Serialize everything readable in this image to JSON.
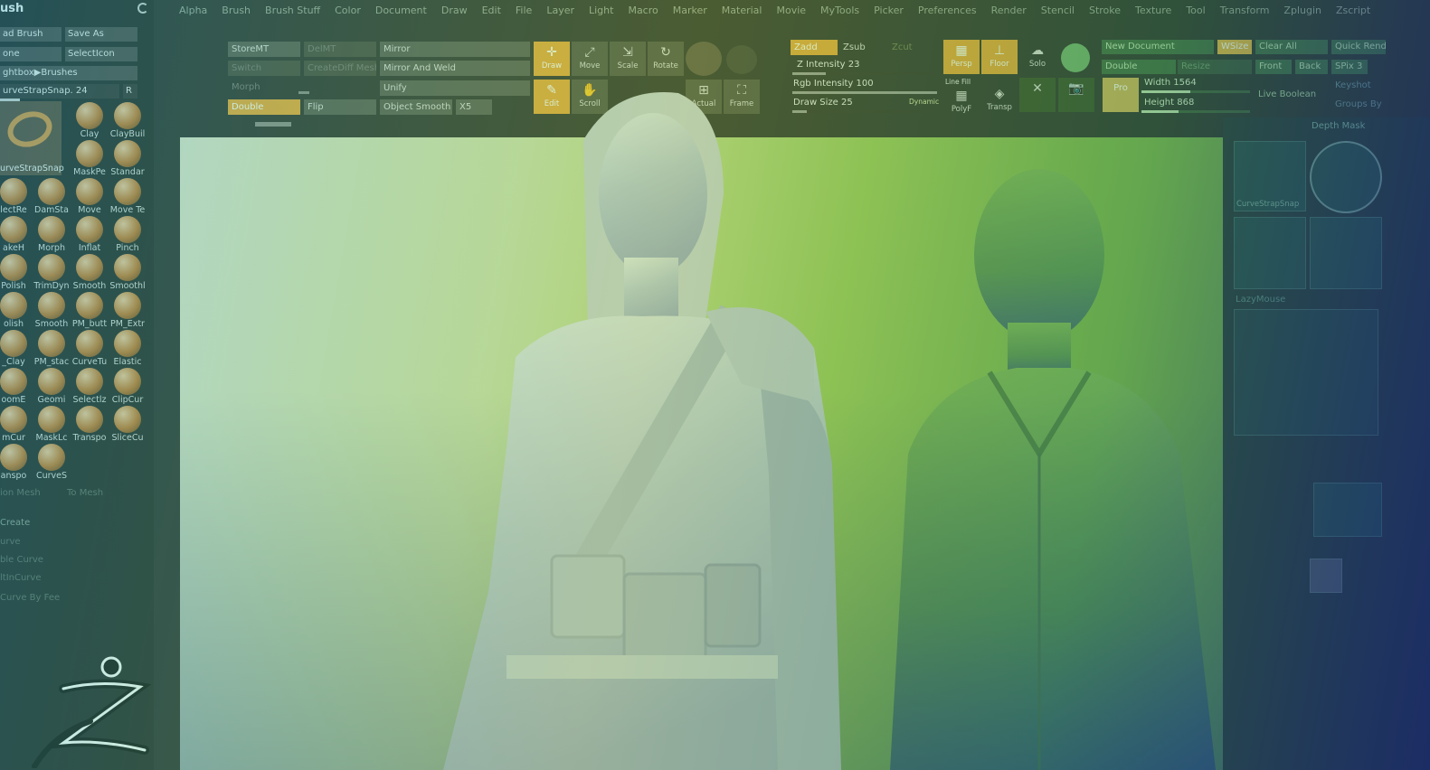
{
  "menu": [
    "Alpha",
    "Brush",
    "Brush Stuff",
    "Color",
    "Document",
    "Draw",
    "Edit",
    "File",
    "Layer",
    "Light",
    "Macro",
    "Marker",
    "Material",
    "Movie",
    "MyTools",
    "Picker",
    "Preferences",
    "Render",
    "Stencil",
    "Stroke",
    "Texture",
    "Tool",
    "Transform",
    "Zplugin",
    "Zscript"
  ],
  "left_panel": {
    "title": "ush",
    "load_brush": "ad Brush",
    "save_as": "Save As",
    "clone": "one",
    "select_icon": "SelectIcon",
    "lightbox_brushes": "ghtbox▶Brushes",
    "current_brush": "urveStrapSnap. 24",
    "r_button": "R",
    "big_brush_label": "urveStrapSnap",
    "brushes": [
      [
        "Clay",
        "ClayBuil"
      ],
      [
        "MaskPe",
        "Standar"
      ],
      [
        "lectRe",
        "DamSta",
        "Move",
        "Move Te"
      ],
      [
        "akeH",
        "Morph",
        "Inflat",
        "Pinch"
      ],
      [
        "Polish",
        "TrimDyn",
        "Smooth",
        "Smoothl"
      ],
      [
        "olish",
        "Smooth",
        "PM_butt",
        "PM_Extr"
      ],
      [
        "_Clay",
        "PM_stac",
        "CurveTu",
        "Elastic"
      ],
      [
        "oomE",
        "Geomi",
        "Selectlz",
        "ClipCur"
      ],
      [
        "mCur",
        "MaskLc",
        "Transpo",
        "SliceCu"
      ],
      [
        "anspo",
        "CurveS"
      ]
    ],
    "faded": [
      "ion Mesh",
      "To Mesh",
      "Create",
      "urve",
      "ble Curve",
      "ltInCurve",
      "Curve By Fee"
    ]
  },
  "toolbar": {
    "store_mt": "StoreMT",
    "del_mt": "DelMT",
    "switch": "Switch",
    "create_diff_mesh": "CreateDiff Mesh",
    "morph": "Morph",
    "double": "Double",
    "flip": "Flip",
    "mirror": "Mirror",
    "mirror_and_weld": "Mirror And Weld",
    "unify": "Unify",
    "object_smooth": "Object Smooth",
    "x5": "X5",
    "draw": "Draw",
    "move": "Move",
    "scale": "Scale",
    "rotate": "Rotate",
    "edit": "Edit",
    "scroll": "Scroll",
    "frame": "Frame",
    "actual": "Actual"
  },
  "sculpt": {
    "zadd": "Zadd",
    "zsub": "Zsub",
    "zcut": "Zcut",
    "z_intensity": "Z Intensity 23",
    "rgb_intensity": "Rgb Intensity 100",
    "draw_size": "Draw Size 25",
    "dynamic": "Dynamic",
    "persp": "Persp",
    "floor": "Floor",
    "solo": "Solo",
    "line_fill": "Line Fill",
    "polyf": "PolyF",
    "transp": "Transp",
    "pro": "Pro",
    "width": "Width 1564",
    "height": "Height 868",
    "z_intensity_value": 23,
    "rgb_intensity_value": 100,
    "draw_size_value": 25
  },
  "document": {
    "new_document": "New Document",
    "wsize": "WSize",
    "clear_all": "Clear All",
    "quick_render": "Quick Rend",
    "double": "Double",
    "resize": "Resize",
    "front": "Front",
    "back": "Back",
    "spix": "SPix 3",
    "live_boolean": "Live Boolean",
    "keyshot": "Keyshot",
    "groups_by": "Groups By",
    "depth_mask": "Depth Mask",
    "curve_strap": "CurveStrapSnap",
    "lazy_mouse": "LazyMouse"
  },
  "colors": {
    "orange": "#e9a436",
    "panel": "#4a4a4a",
    "canvas_green": "#7db34e"
  }
}
